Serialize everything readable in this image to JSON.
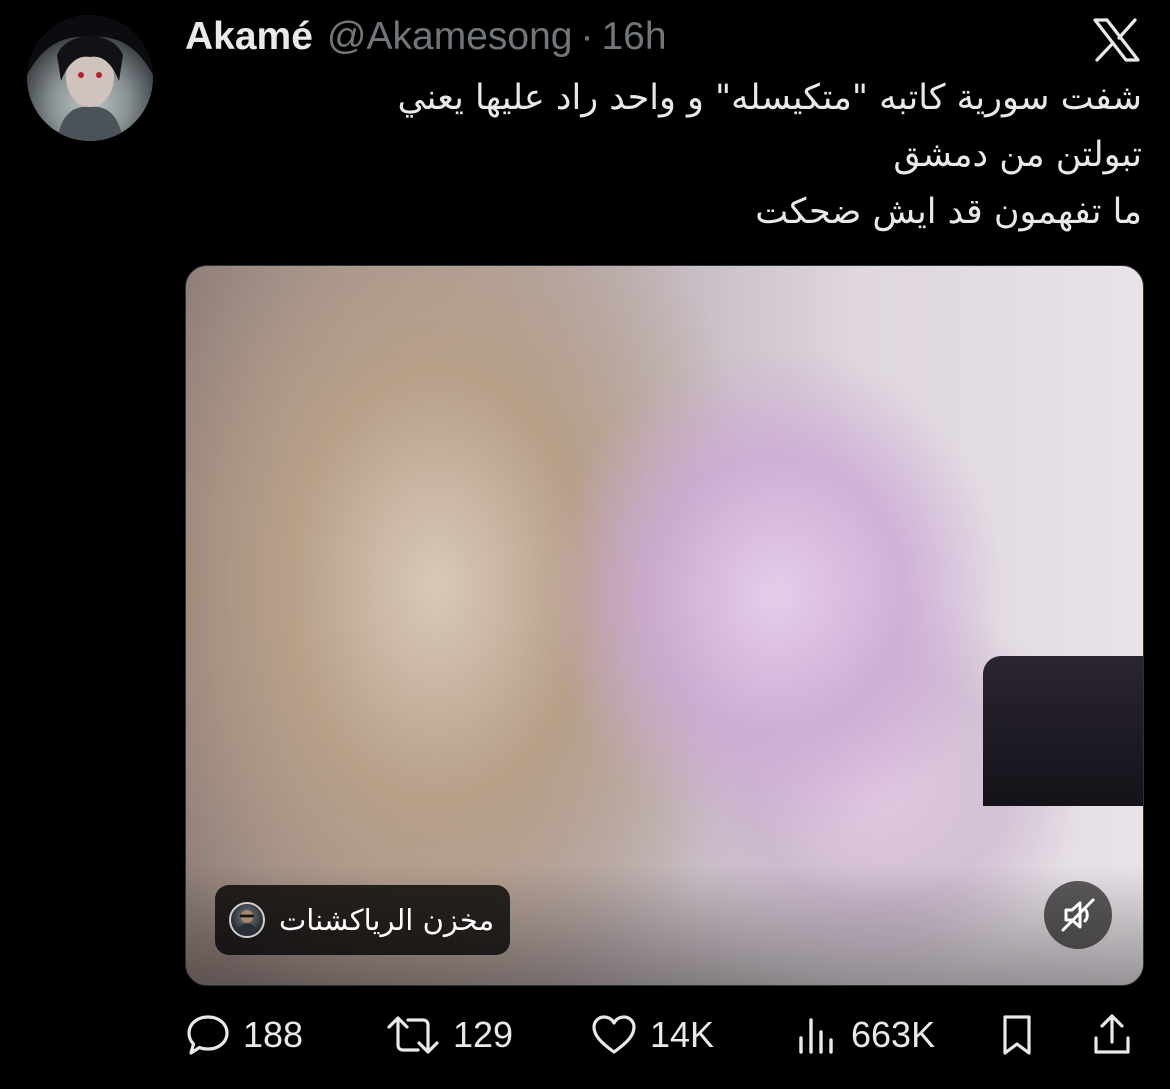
{
  "tweet": {
    "author": {
      "display_name": "Akamé",
      "handle": "@Akamesong",
      "separator": "·",
      "time": "16h"
    },
    "text_lines": [
      "شفت سورية كاتبه \"متكيسله\" و واحد راد عليها يعني",
      "تبولتن من دمشق",
      "ما تفهمون قد ايش ضحكت"
    ],
    "media": {
      "type": "video",
      "source_name": "مخزن الرياكشنات",
      "muted": true,
      "icons": {
        "source_avatar": "source-avatar",
        "mute": "speaker-muted-icon"
      }
    },
    "actions": {
      "replies": "188",
      "reposts": "129",
      "likes": "14K",
      "views": "663K",
      "icons": [
        "reply-icon",
        "repost-icon",
        "like-icon",
        "views-icon",
        "bookmark-icon",
        "share-icon"
      ]
    }
  },
  "app": {
    "logo": "x-logo-icon"
  },
  "colors": {
    "background": "#000000",
    "text": "#e7e9ea",
    "muted": "#71767b"
  }
}
